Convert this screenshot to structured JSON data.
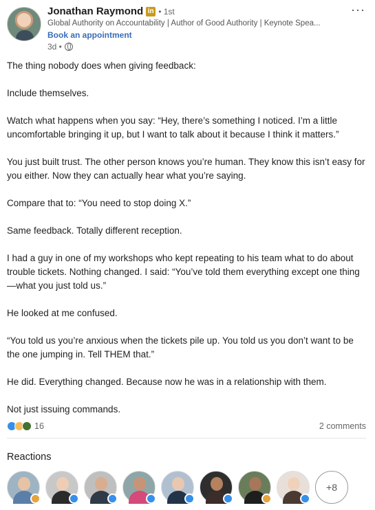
{
  "author": {
    "name": "Jonathan Raymond",
    "badge_text": "in",
    "degree": "• 1st",
    "headline": "Global Authority on Accountability | Author of Good Authority | Keynote Spea...",
    "booking_label": "Book an appointment",
    "time_ago": "3d •",
    "more_label": "···"
  },
  "body": {
    "paragraphs": [
      "The thing nobody does when giving feedback:",
      "Include themselves.",
      "Watch what happens when you say: “Hey, there’s something I noticed. I’m a little uncomfortable bringing it up, but I want to talk about it because I think it matters.”",
      "You just built trust. The other person knows you’re human. They know this isn’t easy for you either. Now they can actually hear what you’re saying.",
      "Compare that to: “You need to stop doing X.”",
      "Same feedback. Totally different reception.",
      "I had a guy in one of my workshops who kept repeating to his team what to do about trouble tickets. Nothing changed. I said: “You’ve told them everything except one thing—what you just told us.”",
      "He looked at me confused.",
      "“You told us you’re anxious when the tickets pile up. You told us you don’t want to be the one jumping in. Tell THEM that.”",
      "He did. Everything changed. Because now he was in a relationship with them.",
      "Not just issuing commands."
    ]
  },
  "social": {
    "reaction_count": "16",
    "comments": "2 comments",
    "reaction_types": [
      "like",
      "insightful",
      "support"
    ]
  },
  "reactions": {
    "title": "Reactions",
    "more_label": "+8",
    "people": [
      {
        "skin": "#e6c3a6",
        "bg": "#9fb4c2",
        "shirt": "#5a7fa8",
        "badge": "insight"
      },
      {
        "skin": "#efcdb4",
        "bg": "#c8c8c8",
        "shirt": "#2b2b2b",
        "badge": "like"
      },
      {
        "skin": "#d9ae90",
        "bg": "#bfbfbf",
        "shirt": "#2f3b48",
        "badge": "like"
      },
      {
        "skin": "#c89477",
        "bg": "#8fa6a8",
        "shirt": "#d44a7a",
        "badge": "like"
      },
      {
        "skin": "#e8c8b0",
        "bg": "#b0c0d0",
        "shirt": "#233449",
        "badge": "like"
      },
      {
        "skin": "#b5815f",
        "bg": "#2e2e2e",
        "shirt": "#3b2d2a",
        "badge": "like"
      },
      {
        "skin": "#a8765a",
        "bg": "#6a7d5a",
        "shirt": "#1e1e1e",
        "badge": "insight"
      },
      {
        "skin": "#f0d2bc",
        "bg": "#e8e0d8",
        "shirt": "#4a3a32",
        "badge": "like"
      }
    ]
  },
  "colors": {
    "link": "#3a6cb8",
    "like": "#378fe9",
    "insightful": "#f5bb5c",
    "support": "#44712e"
  }
}
